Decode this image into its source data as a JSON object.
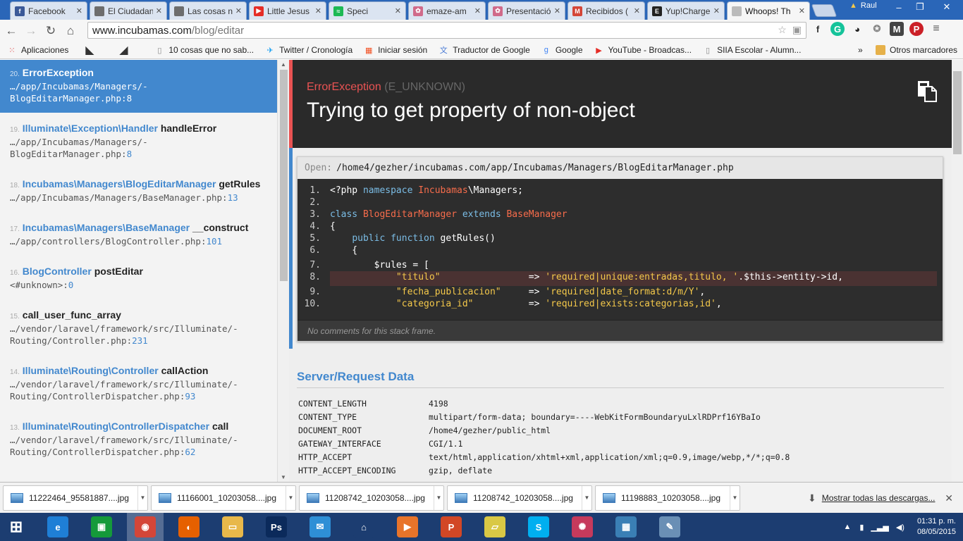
{
  "browser": {
    "tabs": [
      {
        "title": "Facebook",
        "icon": "facebook-icon",
        "color": "#3b5998",
        "glyph": "f"
      },
      {
        "title": "El Ciudadano",
        "icon": "document-icon",
        "color": "#6d6d6d",
        "glyph": ""
      },
      {
        "title": "Las cosas n",
        "icon": "document-icon",
        "color": "#6d6d6d",
        "glyph": ""
      },
      {
        "title": "Little Jesus",
        "icon": "youtube-icon",
        "color": "#e52d27",
        "glyph": "▶"
      },
      {
        "title": "Speci",
        "icon": "spotify-icon",
        "color": "#1db954",
        "glyph": "≈"
      },
      {
        "title": "emaze-am",
        "icon": "emaze-icon",
        "color": "#d06a8a",
        "glyph": "✿"
      },
      {
        "title": "Presentació",
        "icon": "emaze-icon",
        "color": "#d06a8a",
        "glyph": "✿"
      },
      {
        "title": "Recibidos (",
        "icon": "gmail-icon",
        "color": "#d44638",
        "glyph": "M"
      },
      {
        "title": "Yup!Charge",
        "icon": "e-icon",
        "color": "#222222",
        "glyph": "E"
      },
      {
        "title": "Whoops! Th",
        "icon": "document-icon",
        "color": "#bbbbbb",
        "glyph": ""
      }
    ],
    "user": "Raul",
    "url_host": "www.incubamas.com",
    "url_path": "/blog/editar",
    "bookmarks": [
      {
        "label": "Aplicaciones",
        "icon": "apps-icon"
      },
      {
        "label": "",
        "icon": "k-logo-icon"
      },
      {
        "label": "",
        "icon": "arrow-logo-icon"
      },
      {
        "label": "10 cosas que no sab...",
        "icon": "page-icon"
      },
      {
        "label": "Twitter / Cronología",
        "icon": "twitter-icon"
      },
      {
        "label": "Iniciar sesión",
        "icon": "windows-icon"
      },
      {
        "label": "Traductor de Google",
        "icon": "translate-icon"
      },
      {
        "label": "Google",
        "icon": "google-icon"
      },
      {
        "label": "YouTube - Broadcas...",
        "icon": "youtube-icon"
      },
      {
        "label": "SIIA Escolar - Alumn...",
        "icon": "page-icon"
      }
    ],
    "more_bookmarks": "»",
    "other_bookmarks": "Otros marcadores"
  },
  "whoops": {
    "frames": [
      {
        "num": "20.",
        "cls": "ErrorException",
        "fn": "",
        "file": "…/app/Incubamas/Managers/-\nBlogEditarManager.php",
        "line": "8"
      },
      {
        "num": "19.",
        "cls": "Illuminate\\Exception\\Handler",
        "fn": "handleError",
        "file": "…/app/Incubamas/Managers/-\nBlogEditarManager.php",
        "line": "8"
      },
      {
        "num": "18.",
        "cls": "Incubamas\\Managers\\BlogEditarManager",
        "fn": "getRules",
        "file": "…/app/Incubamas/Managers/BaseManager.php",
        "line": "13"
      },
      {
        "num": "17.",
        "cls": "Incubamas\\Managers\\BaseManager",
        "fn": "__construct",
        "file": "…/app/controllers/BlogController.php",
        "line": "101"
      },
      {
        "num": "16.",
        "cls": "BlogController",
        "fn": "postEditar",
        "file": "<#unknown>",
        "line": "0"
      },
      {
        "num": "15.",
        "cls": "",
        "fn": "call_user_func_array",
        "file": "…/vendor/laravel/framework/src/Illuminate/-\nRouting/Controller.php",
        "line": "231"
      },
      {
        "num": "14.",
        "cls": "Illuminate\\Routing\\Controller",
        "fn": "callAction",
        "file": "…/vendor/laravel/framework/src/Illuminate/-\nRouting/ControllerDispatcher.php",
        "line": "93"
      },
      {
        "num": "13.",
        "cls": "Illuminate\\Routing\\ControllerDispatcher",
        "fn": "call",
        "file": "…/vendor/laravel/framework/src/Illuminate/-\nRouting/ControllerDispatcher.php",
        "line": "62"
      }
    ],
    "exception_class": "ErrorException",
    "exception_code": "(E_UNKNOWN)",
    "message": "Trying to get property of non-object",
    "open_label": "Open:",
    "open_path": "/home4/gezher/incubamas.com/app/Incubamas/Managers/BlogEditarManager.php",
    "code_lines": [
      {
        "n": "1.",
        "hl": false,
        "parts": [
          [
            "t",
            "<?php "
          ],
          [
            "kw",
            "namespace "
          ],
          [
            "cn",
            "Incubamas"
          ],
          [
            "t",
            "\\Managers;"
          ]
        ]
      },
      {
        "n": "2.",
        "hl": false,
        "parts": []
      },
      {
        "n": "3.",
        "hl": false,
        "parts": [
          [
            "kw",
            "class "
          ],
          [
            "cn",
            "BlogEditarManager "
          ],
          [
            "kw",
            "extends "
          ],
          [
            "cn",
            "BaseManager"
          ]
        ]
      },
      {
        "n": "4.",
        "hl": false,
        "parts": [
          [
            "t",
            "{"
          ]
        ]
      },
      {
        "n": "5.",
        "hl": false,
        "parts": [
          [
            "t",
            "    "
          ],
          [
            "kw",
            "public function "
          ],
          [
            "t",
            "getRules()"
          ]
        ]
      },
      {
        "n": "6.",
        "hl": false,
        "parts": [
          [
            "t",
            "    {"
          ]
        ]
      },
      {
        "n": "7.",
        "hl": false,
        "parts": [
          [
            "t",
            "        $rules = ["
          ]
        ]
      },
      {
        "n": "8.",
        "hl": true,
        "parts": [
          [
            "t",
            "            "
          ],
          [
            "st",
            "\"titulo\""
          ],
          [
            "t",
            "                => "
          ],
          [
            "st",
            "'required|unique:entradas,titulo, '"
          ],
          [
            "t",
            ".$this->entity->id,"
          ]
        ]
      },
      {
        "n": "9.",
        "hl": false,
        "parts": [
          [
            "t",
            "            "
          ],
          [
            "st",
            "\"fecha_publicacion\""
          ],
          [
            "t",
            "     => "
          ],
          [
            "st",
            "'required|date_format:d/m/Y'"
          ],
          [
            "t",
            ","
          ]
        ]
      },
      {
        "n": "10.",
        "hl": false,
        "parts": [
          [
            "t",
            "            "
          ],
          [
            "st",
            "\"categoria_id\""
          ],
          [
            "t",
            "          => "
          ],
          [
            "st",
            "'required|exists:categorias,id'"
          ],
          [
            "t",
            ","
          ]
        ]
      }
    ],
    "no_comments": "No comments for this stack frame.",
    "server_title": "Server/Request Data",
    "server_data": [
      {
        "k": "CONTENT_LENGTH",
        "v": "4198"
      },
      {
        "k": "CONTENT_TYPE",
        "v": "multipart/form-data; boundary=----WebKitFormBoundaryuLxlRDPrf16YBaIo"
      },
      {
        "k": "DOCUMENT_ROOT",
        "v": "/home4/gezher/public_html"
      },
      {
        "k": "GATEWAY_INTERFACE",
        "v": "CGI/1.1"
      },
      {
        "k": "HTTP_ACCEPT",
        "v": "text/html,application/xhtml+xml,application/xml;q=0.9,image/webp,*/*;q=0.8"
      },
      {
        "k": "HTTP_ACCEPT_ENCODING",
        "v": "gzip, deflate"
      }
    ]
  },
  "downloads": {
    "items": [
      "11222464_95581887....jpg",
      "11166001_10203058....jpg",
      "11208742_10203058....jpg",
      "11208742_10203058....jpg",
      "11198883_10203058....jpg"
    ],
    "show_all": "Mostrar todas las descargas..."
  },
  "taskbar": {
    "apps": [
      {
        "name": "windows-start-icon",
        "color": "#1c3d71",
        "glyph": "⊞"
      },
      {
        "name": "internet-explorer-icon",
        "color": "#1f7fd6",
        "glyph": "e"
      },
      {
        "name": "store-icon",
        "color": "#159a3a",
        "glyph": "▣"
      },
      {
        "name": "chrome-icon",
        "color": "#d44638",
        "glyph": "◉"
      },
      {
        "name": "firefox-icon",
        "color": "#e66000",
        "glyph": "◐"
      },
      {
        "name": "file-explorer-icon",
        "color": "#e8b84a",
        "glyph": "▭"
      },
      {
        "name": "photoshop-icon",
        "color": "#0b2a5b",
        "glyph": "Ps"
      },
      {
        "name": "outlook-icon",
        "color": "#2e8fd6",
        "glyph": "✉"
      },
      {
        "name": "home-icon",
        "color": "#1c3d71",
        "glyph": "⌂"
      },
      {
        "name": "media-player-icon",
        "color": "#e8742a",
        "glyph": "▶"
      },
      {
        "name": "powerpoint-icon",
        "color": "#d24726",
        "glyph": "P"
      },
      {
        "name": "sticky-notes-icon",
        "color": "#d9c845",
        "glyph": "▱"
      },
      {
        "name": "skype-icon",
        "color": "#00aff0",
        "glyph": "S"
      },
      {
        "name": "peacock-icon",
        "color": "#c63a5c",
        "glyph": "✺"
      },
      {
        "name": "photos-icon",
        "color": "#3a7fb5",
        "glyph": "▦"
      },
      {
        "name": "paint-icon",
        "color": "#6a8fb5",
        "glyph": "✎"
      }
    ],
    "time": "01:31 p. m.",
    "date": "08/05/2015"
  }
}
